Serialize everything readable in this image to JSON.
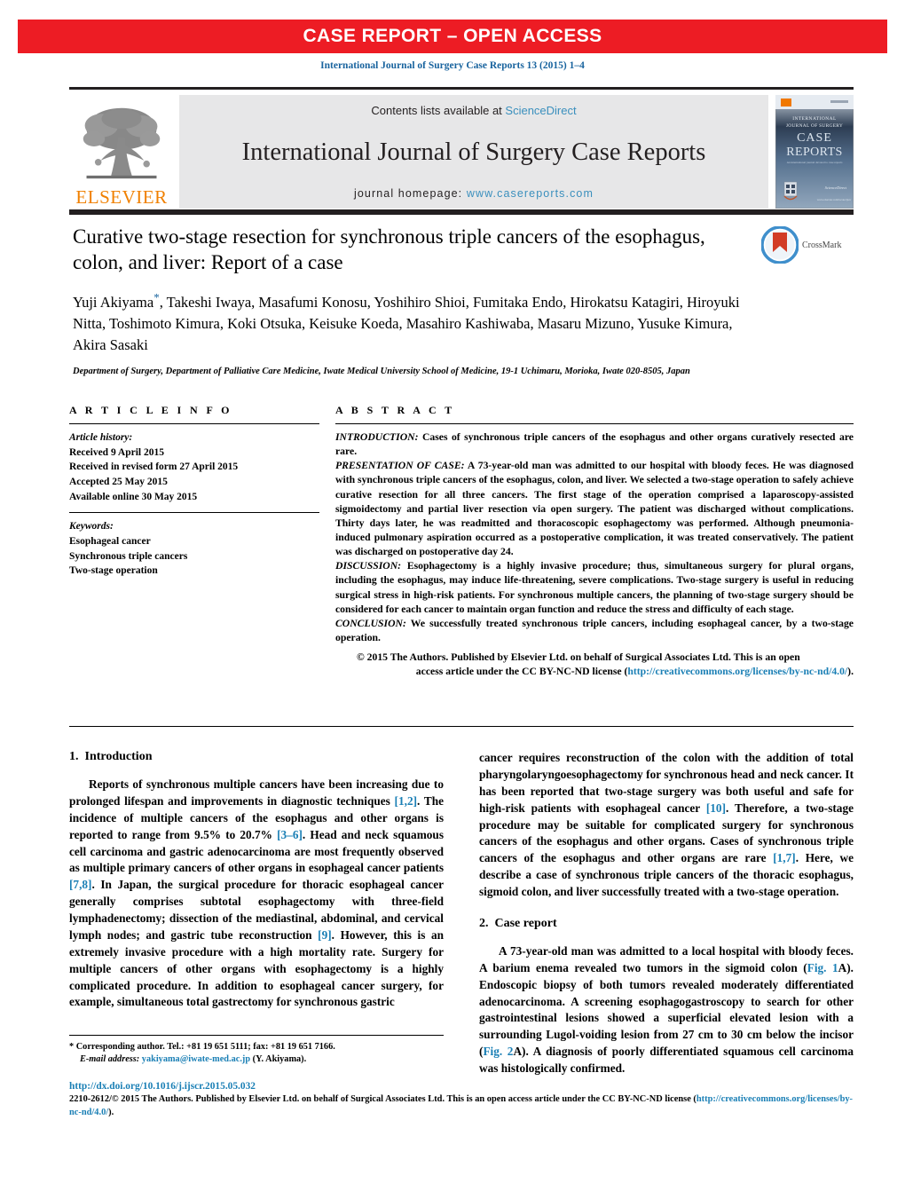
{
  "banner": {
    "text": "CASE REPORT – OPEN ACCESS",
    "color": "#ED1C24"
  },
  "citation": "International Journal of Surgery Case Reports 13 (2015) 1–4",
  "masthead": {
    "publisher_name": "ELSEVIER",
    "publisher_logo_icon": "elsevier-tree-icon",
    "contents_prefix": "Contents lists available at ",
    "contents_link": "ScienceDirect",
    "journal_name": "International Journal of Surgery Case Reports",
    "homepage_prefix": "journal homepage: ",
    "homepage_url": "www.casereports.com",
    "cover": {
      "line1": "INTERNATIONAL",
      "line2": "JOURNAL OF SURGERY",
      "line3": "CASE",
      "line4": "REPORTS",
      "tagline": "An international journal devoted to the publication of case reports",
      "footer_url": "www.elsevier.com/locate/ijscr"
    }
  },
  "crossmark": {
    "label": "CrossMark",
    "icon": "crossmark-icon"
  },
  "article": {
    "title": "Curative two-stage resection for synchronous triple cancers of the esophagus, colon, and liver: Report of a case",
    "authors": "Yuji Akiyama, Takeshi Iwaya, Masafumi Konosu, Yoshihiro Shioi, Fumitaka Endo, Hirokatsu Katagiri, Hiroyuki Nitta, Toshimoto Kimura, Koki Otsuka, Keisuke Koeda, Masahiro Kashiwaba, Masaru Mizuno, Yusuke Kimura, Akira Sasaki",
    "corresponding_marker": "*",
    "affiliation": "Department of Surgery, Department of Palliative Care Medicine, Iwate Medical University School of Medicine, 19-1 Uchimaru, Morioka, Iwate 020-8505, Japan"
  },
  "article_info": {
    "heading": "A R T I C L E    I N F O",
    "history_label": "Article history:",
    "history": [
      "Received 9 April 2015",
      "Received in revised form 27 April 2015",
      "Accepted 25 May 2015",
      "Available online 30 May 2015"
    ],
    "keywords_label": "Keywords:",
    "keywords": [
      "Esophageal cancer",
      "Synchronous triple cancers",
      "Two-stage operation"
    ]
  },
  "abstract": {
    "heading": "A B S T R A C T",
    "sections": [
      {
        "lead": "INTRODUCTION:",
        "text": " Cases of synchronous triple cancers of the esophagus and other organs curatively resected are rare."
      },
      {
        "lead": "PRESENTATION OF CASE:",
        "text": " A 73-year-old man was admitted to our hospital with bloody feces. He was diagnosed with synchronous triple cancers of the esophagus, colon, and liver. We selected a two-stage operation to safely achieve curative resection for all three cancers. The first stage of the operation comprised a laparoscopy-assisted sigmoidectomy and partial liver resection via open surgery. The patient was discharged without complications. Thirty days later, he was readmitted and thoracoscopic esophagectomy was performed. Although pneumonia-induced pulmonary aspiration occurred as a postoperative complication, it was treated conservatively. The patient was discharged on postoperative day 24."
      },
      {
        "lead": "DISCUSSION:",
        "text": " Esophagectomy is a highly invasive procedure; thus, simultaneous surgery for plural organs, including the esophagus, may induce life-threatening, severe complications. Two-stage surgery is useful in reducing surgical stress in high-risk patients. For synchronous multiple cancers, the planning of two-stage surgery should be considered for each cancer to maintain organ function and reduce the stress and difficulty of each stage."
      },
      {
        "lead": "CONCLUSION:",
        "text": " We successfully treated synchronous triple cancers, including esophageal cancer, by a two-stage operation."
      }
    ],
    "copyright_line1": "© 2015 The Authors. Published by Elsevier Ltd. on behalf of Surgical Associates Ltd. This is an open",
    "copyright_line2_prefix": "access article under the CC BY-NC-ND license (",
    "copyright_license_url": "http://creativecommons.org/licenses/by-nc-nd/4.0/",
    "copyright_line2_suffix": ")."
  },
  "body": {
    "left": {
      "section_number": "1.",
      "section_title": "Introduction",
      "paragraph_part1": "Reports of synchronous multiple cancers have been increasing due to prolonged lifespan and improvements in diagnostic techniques ",
      "ref_1_2": "[1,2]",
      "paragraph_part2": ". The incidence of multiple cancers of the esophagus and other organs is reported to range from 9.5% to 20.7% ",
      "ref_3_6": "[3–6]",
      "paragraph_part3": ". Head and neck squamous cell carcinoma and gastric adenocarcinoma are most frequently observed as multiple primary cancers of other organs in esophageal cancer patients ",
      "ref_7_8": "[7,8]",
      "paragraph_part4": ". In Japan, the surgical procedure for thoracic esophageal cancer generally comprises subtotal esophagectomy with three-field lymphadenectomy; dissection of the mediastinal, abdominal, and cervical lymph nodes; and gastric tube reconstruction ",
      "ref_9": "[9]",
      "paragraph_part5": ". However, this is an extremely invasive procedure with a high mortality rate. Surgery for multiple cancers of other organs with esophagectomy is a highly complicated procedure. In addition to esophageal cancer surgery, for example, simultaneous total gastrectomy for synchronous gastric"
    },
    "right": {
      "cont_part1": "cancer requires reconstruction of the colon with the addition of total pharyngolaryngoesophagectomy for synchronous head and neck cancer. It has been reported that two-stage surgery was both useful and safe for high-risk patients with esophageal cancer ",
      "ref_10": "[10]",
      "cont_part2": ". Therefore, a two-stage procedure may be suitable for complicated surgery for synchronous cancers of the esophagus and other organs. Cases of synchronous triple cancers of the esophagus and other organs are rare ",
      "ref_1_7": "[1,7]",
      "cont_part3": ". Here, we describe a case of synchronous triple cancers of the thoracic esophagus, sigmoid colon, and liver successfully treated with a two-stage operation.",
      "section_number": "2.",
      "section_title": "Case report",
      "case_part1": "A 73-year-old man was admitted to a local hospital with bloody feces. A barium enema revealed two tumors in the sigmoid colon (",
      "fig1_ref": "Fig. 1",
      "case_part2": "A). Endoscopic biopsy of both tumors revealed moderately differentiated adenocarcinoma. A screening esophagogastroscopy to search for other gastrointestinal lesions showed a superficial elevated lesion with a surrounding Lugol-voiding lesion from 27 cm to 30 cm below the incisor (",
      "fig2_ref": "Fig. 2",
      "case_part3": "A). A diagnosis of poorly differentiated squamous cell carcinoma was histologically confirmed."
    }
  },
  "footnote": {
    "marker": "*",
    "corresponding": "Corresponding author. Tel.: +81 19 651 5111; fax: +81 19 651 7166.",
    "email_label": "E-mail address:",
    "email": "yakiyama@iwate-med.ac.jp",
    "email_suffix": "(Y. Akiyama)."
  },
  "footer": {
    "doi_url": "http://dx.doi.org/10.1016/j.ijscr.2015.05.032",
    "issn_line_part1": "2210-2612/© 2015 The Authors. Published by Elsevier Ltd. on behalf of Surgical Associates Ltd. This is an open access article under the CC BY-NC-ND license (",
    "issn_license_url": "http://creativecommons.org/licenses/by-nc-nd/4.0/",
    "issn_line_part2": ")."
  },
  "colors": {
    "banner_red": "#ED1C24",
    "link_blue": "#1a7fb5",
    "elsevier_orange": "#F08000",
    "band_gray": "#e7e7e8",
    "rule_dark": "#231f20"
  }
}
